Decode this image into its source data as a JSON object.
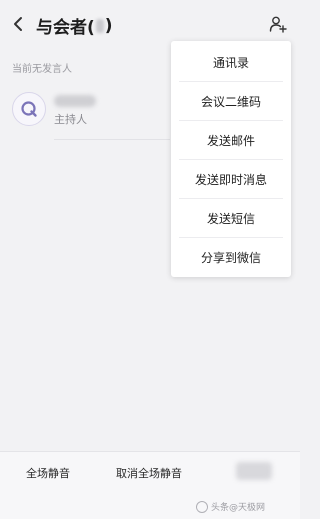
{
  "header": {
    "title": "与会者(",
    "title_close": ")",
    "back_icon": "chevron-left-icon",
    "add_user_icon": "add-user-icon"
  },
  "status": {
    "speaker_text": "当前无发言人"
  },
  "participants": [
    {
      "role": "主持人",
      "avatar_icon": "q-avatar-icon"
    }
  ],
  "menu": {
    "items": [
      {
        "label": "通讯录"
      },
      {
        "label": "会议二维码"
      },
      {
        "label": "发送邮件"
      },
      {
        "label": "发送即时消息"
      },
      {
        "label": "发送短信"
      },
      {
        "label": "分享到微信"
      }
    ]
  },
  "bottom_bar": {
    "mute_all_label": "全场静音",
    "unmute_all_label": "取消全场静音"
  },
  "watermark": {
    "text": "头条@天极网"
  },
  "colors": {
    "background": "#f2f2f4",
    "menu_background": "#ffffff",
    "avatar_ring": "#d9d6ea"
  }
}
